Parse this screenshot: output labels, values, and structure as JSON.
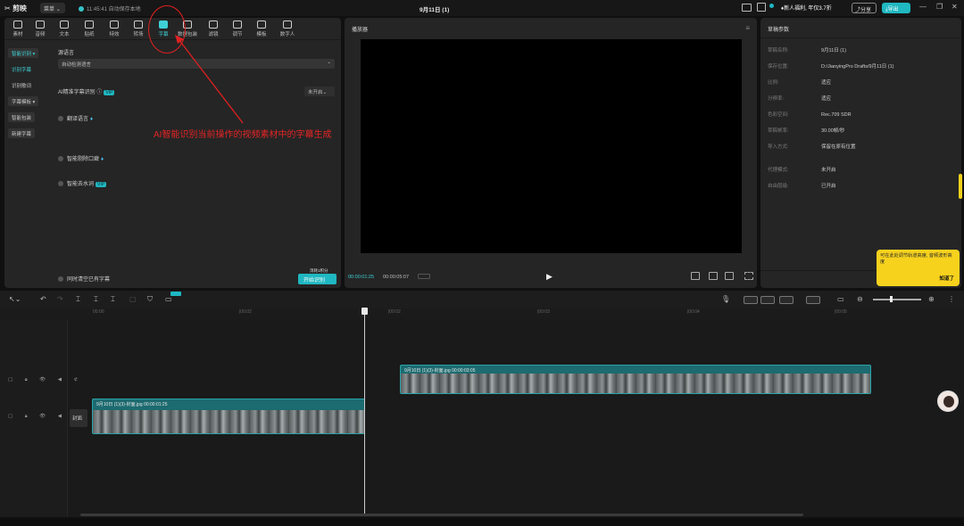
{
  "titlebar": {
    "logo": "剪映",
    "menu": "菜单",
    "autosave": "11:45:41 自动保存本地",
    "doc_title": "9月11日 (1)",
    "promo": "新人福利, 年仅3.7折",
    "share": "分享",
    "export": "导出"
  },
  "toolbar": {
    "tools": [
      {
        "label": "素材",
        "icon": "media-icon"
      },
      {
        "label": "音频",
        "icon": "audio-icon"
      },
      {
        "label": "文本",
        "icon": "text-icon"
      },
      {
        "label": "贴纸",
        "icon": "sticker-icon"
      },
      {
        "label": "特效",
        "icon": "effects-icon"
      },
      {
        "label": "转场",
        "icon": "transition-icon"
      },
      {
        "label": "字幕",
        "icon": "subtitle-icon",
        "active": true
      },
      {
        "label": "数据包装",
        "icon": "data-package-icon"
      },
      {
        "label": "滤镜",
        "icon": "filter-icon"
      },
      {
        "label": "调节",
        "icon": "adjust-icon"
      },
      {
        "label": "模板",
        "icon": "template-icon"
      },
      {
        "label": "数字人",
        "icon": "digital-human-icon"
      }
    ]
  },
  "subnav": [
    "智能识别",
    "识别字幕",
    "识别歌词",
    "字幕模板",
    "智能包装",
    "新建字幕"
  ],
  "subtitle_panel": {
    "lang_label": "源语言",
    "lang_value": "自动检测语言",
    "ai_label": "AI精准字幕识别",
    "ai_badge": "VIP",
    "ai_toggle": "未开启",
    "translate_label": "翻译语言",
    "remove_filler_label": "智能剔除口癖",
    "filler_label": "智能去水词",
    "filler_badge": "VIP",
    "clear_existing": "同时清空已有字幕",
    "gen_note": "消耗1积分",
    "generate": "开始识别"
  },
  "player": {
    "title": "播放器",
    "time_current": "00:00:01:25",
    "time_total": "00:00:05:07"
  },
  "meta": {
    "title": "草稿参数",
    "rows": [
      {
        "k": "草稿名称:",
        "v": "9月11日 (1)"
      },
      {
        "k": "保存位置:",
        "v": "D:/JianyingPro Drafts/9月11日 (1)"
      },
      {
        "k": "比例:",
        "v": "适应"
      },
      {
        "k": "分辨率:",
        "v": "适应"
      },
      {
        "k": "色彩空间:",
        "v": "Rec.709 SDR"
      },
      {
        "k": "草稿帧率:",
        "v": "30.00帧/秒"
      },
      {
        "k": "导入方式:",
        "v": "保留在原有位置"
      },
      {
        "k": "代理模式:",
        "v": "未开启"
      },
      {
        "k": "自由层级:",
        "v": "已开启"
      }
    ]
  },
  "tip": {
    "text": "可在此处调节轨道高度, 音频波形高度",
    "ok": "知道了"
  },
  "annotation": {
    "text": "AI智能识别当前操作的视频素材中的字幕生成"
  },
  "timeline": {
    "ticks": [
      "00:00",
      "|00:02",
      "|00:02",
      "|00:03",
      "|00:04",
      "|00:05"
    ],
    "cover": "封面",
    "clip1": "9月10日 (1)(3)-封面.jpg  00:00:01:25",
    "clip2": "9月10日 (1)(3)-封面.jpg  00:00:03:05"
  }
}
